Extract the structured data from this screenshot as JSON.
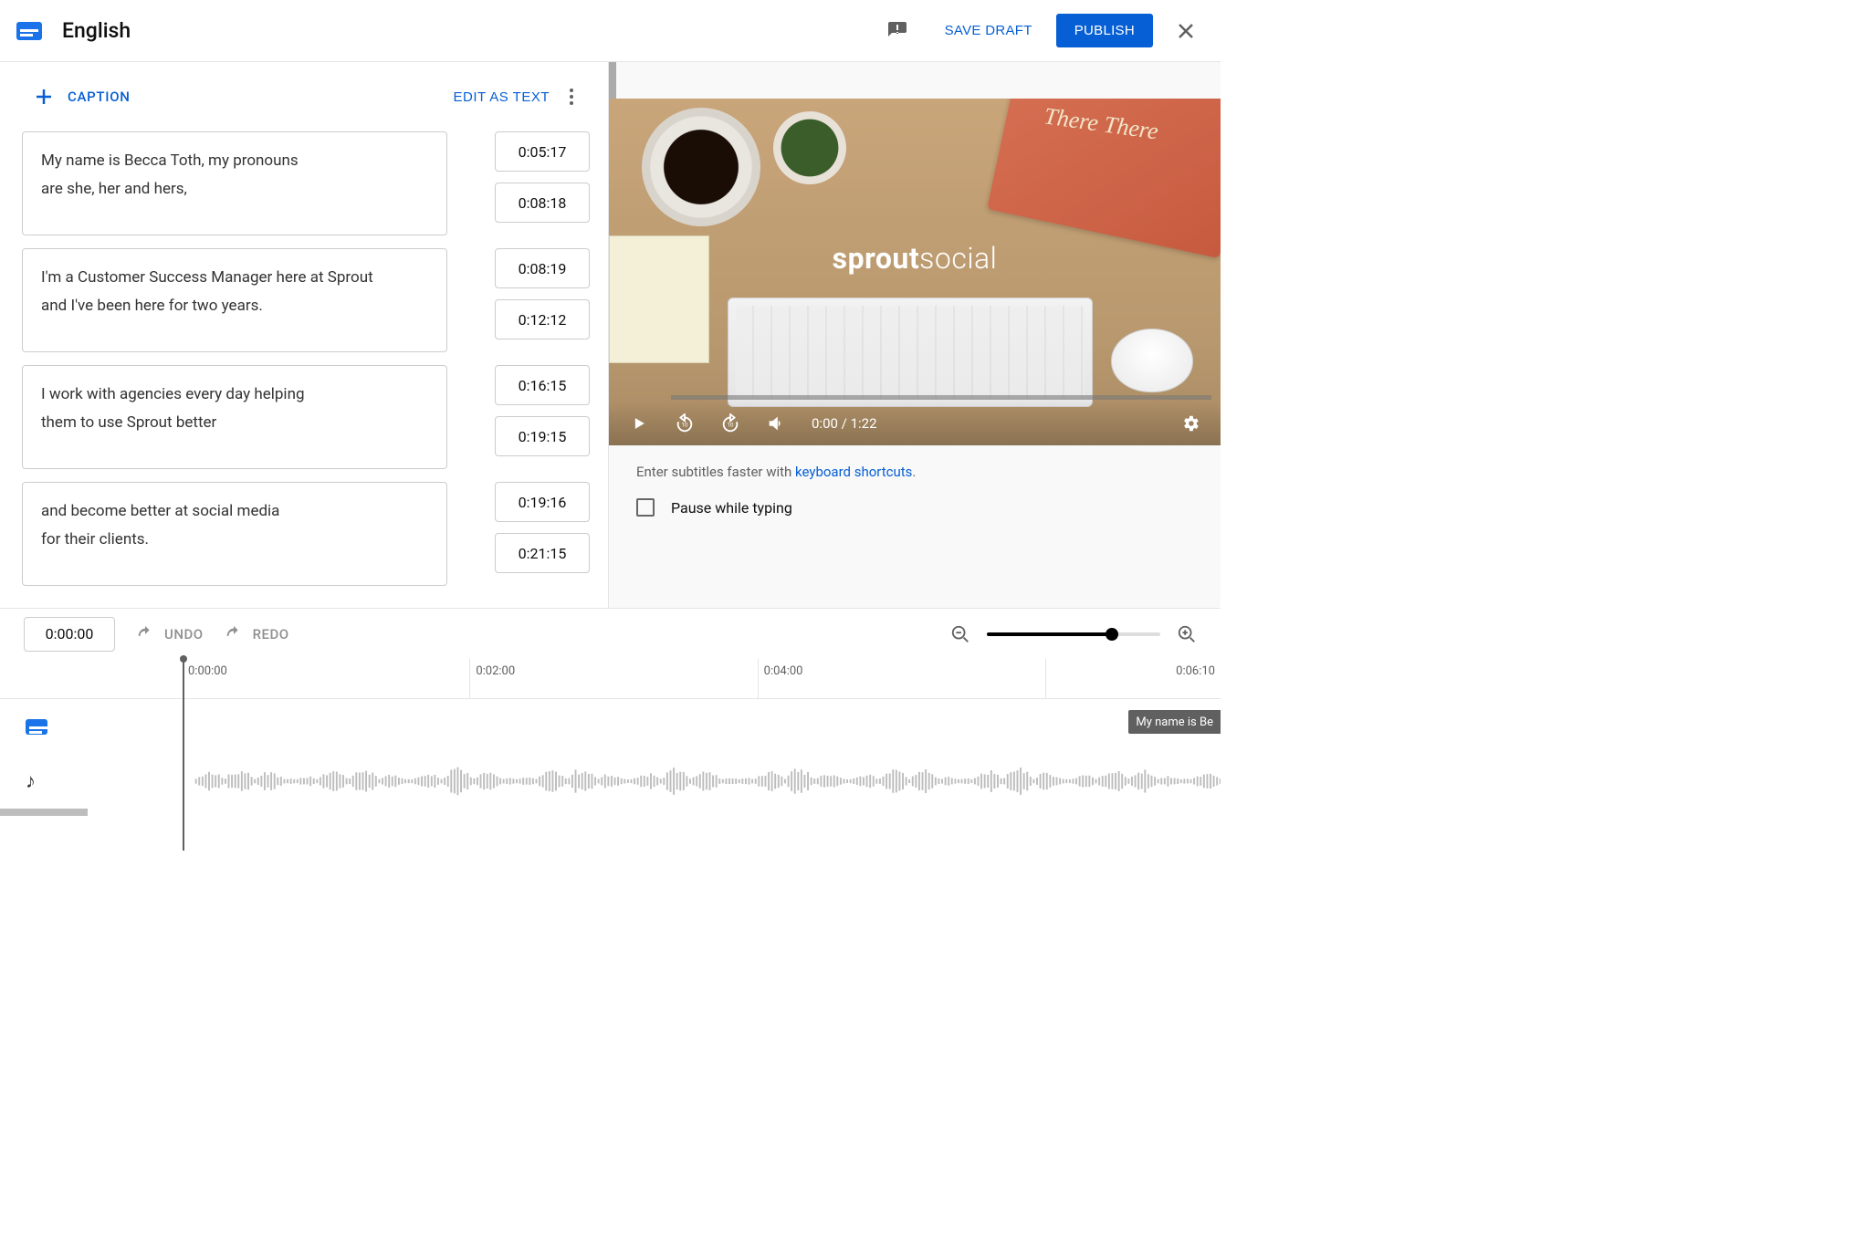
{
  "header": {
    "language": "English",
    "save_draft": "SAVE DRAFT",
    "publish": "PUBLISH"
  },
  "left_toolbar": {
    "caption_label": "CAPTION",
    "edit_as_text": "EDIT AS TEXT"
  },
  "captions": [
    {
      "line1": "My name is Becca Toth, my pronouns",
      "line2": "are she, her and hers,",
      "start": "0:05:17",
      "end": "0:08:18"
    },
    {
      "line1": "I'm a Customer Success Manager here at Sprout",
      "line2": "and I've been here for two years.",
      "start": "0:08:19",
      "end": "0:12:12"
    },
    {
      "line1": "I work with agencies every day helping",
      "line2": "them to use Sprout better",
      "start": "0:16:15",
      "end": "0:19:15"
    },
    {
      "line1": "and become better at social media",
      "line2": "for their clients.",
      "start": "0:19:16",
      "end": "0:21:15"
    }
  ],
  "video": {
    "brand_bold": "sprout",
    "brand_light": "social",
    "current": "0:00",
    "duration": "1:22"
  },
  "hint": {
    "prefix": "Enter subtitles faster with ",
    "link": "keyboard shortcuts",
    "suffix": "."
  },
  "pause_while_typing": "Pause while typing",
  "timeline": {
    "position": "0:00:00",
    "undo": "UNDO",
    "redo": "REDO",
    "ticks": [
      "0:00:00",
      "0:02:00",
      "0:04:00",
      "0:06:10"
    ],
    "chip": "My name is Be"
  }
}
